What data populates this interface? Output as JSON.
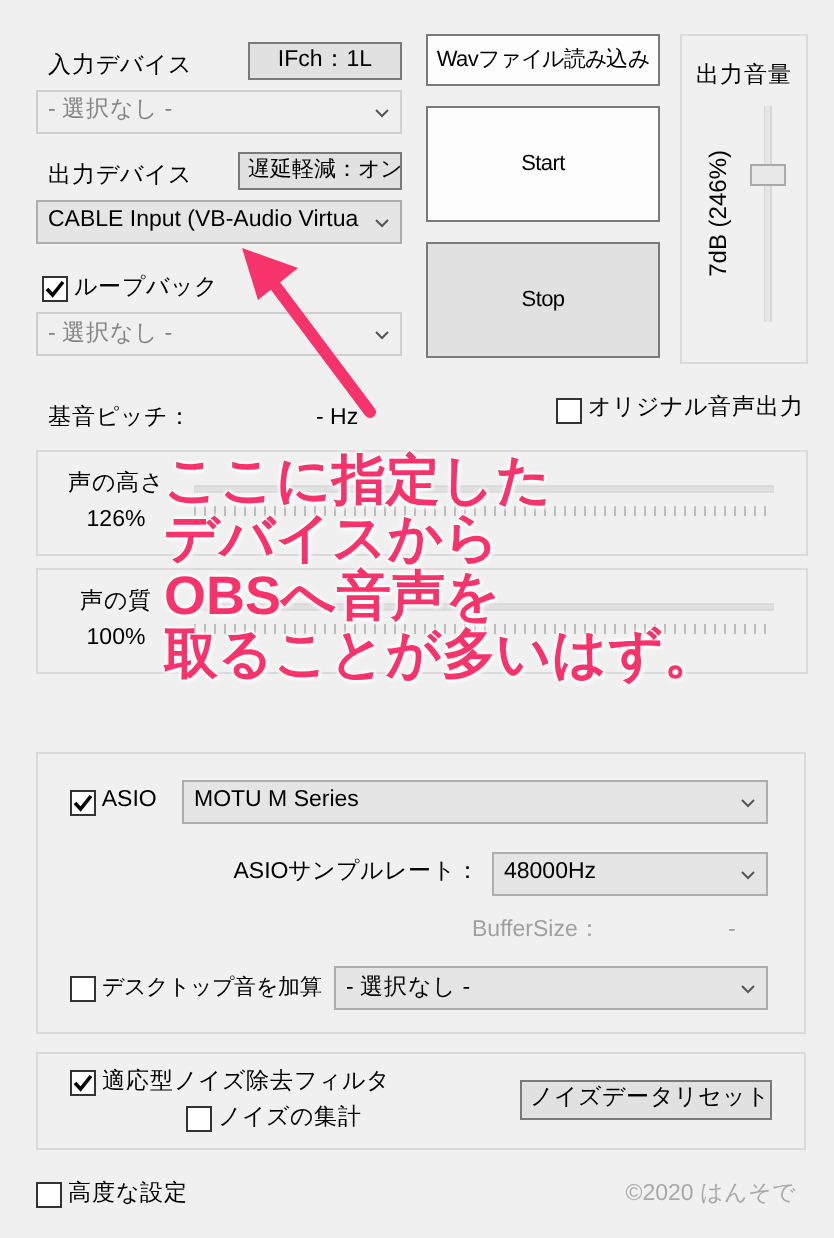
{
  "input_device": {
    "label": "入力デバイス",
    "ifch_button": "IFch：1L",
    "select": {
      "value": "- 選択なし -",
      "disabled": true
    }
  },
  "output_device": {
    "label": "出力デバイス",
    "latency_button": "遅延軽減：オン",
    "select": {
      "value": "CABLE Input (VB-Audio Virtua",
      "disabled": false
    }
  },
  "loopback": {
    "label": "ループバック",
    "checked": true,
    "select": {
      "value": "- 選択なし -",
      "disabled": true
    }
  },
  "buttons": [
    {
      "label": "Wavファイル読み込み",
      "active": false
    },
    {
      "label": "Start",
      "active": false
    },
    {
      "label": "Stop",
      "active": true
    }
  ],
  "output_volume": {
    "title": "出力音量",
    "reading": "7dB (246%)",
    "level": 0.7
  },
  "pitch": {
    "label": "基音ピッチ：",
    "value": "- Hz"
  },
  "original_output": {
    "label": "オリジナル音声出力",
    "checked": false
  },
  "voice_sliders": [
    {
      "label": "声の高さ",
      "reading": "126%"
    },
    {
      "label": "声の質",
      "reading": "100%"
    }
  ],
  "asio": {
    "label": "ASIO",
    "checked": true,
    "device": "MOTU M Series",
    "sample_rate_label": "ASIOサンプルレート：",
    "sample_rate": "48000Hz",
    "buffer_label": "BufferSize：",
    "buffer_value": "-",
    "buffer_disabled": true
  },
  "desktop_sound": {
    "label": "デスクトップ音を加算",
    "checked": false,
    "select": "- 選択なし -"
  },
  "noise_filter": {
    "label": "適応型ノイズ除去フィルタ",
    "checked": true
  },
  "noise_stats": {
    "label": "ノイズの集計",
    "checked": false
  },
  "noise_reset_button": "ノイズデータリセット",
  "advanced": {
    "label": "高度な設定",
    "checked": false
  },
  "copyright": "©2020 はんそで",
  "annotation": {
    "lines": [
      "ここに指定した",
      "デバイスから",
      "OBSへ音声を",
      "取ることが多いはず。"
    ]
  }
}
